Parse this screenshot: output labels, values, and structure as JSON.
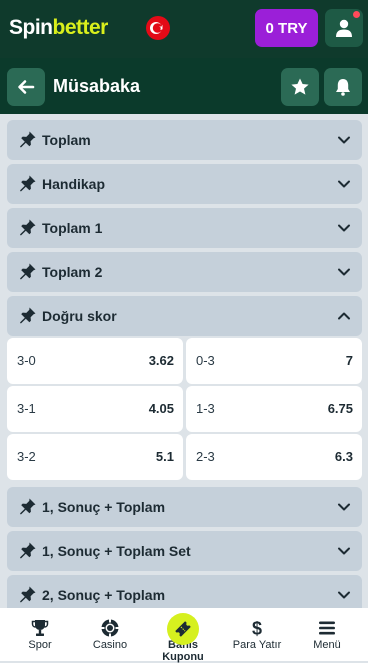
{
  "header": {
    "logo_part1": "Spin",
    "logo_part2": "better",
    "flag_icon": "turkey-flag-icon",
    "balance": "0 TRY",
    "colors": {
      "header_bg": "#0f3a2c",
      "balance_bg": "#9b1fd8",
      "accent_lime": "#d9ef1c"
    }
  },
  "subheader": {
    "title": "Müsabaka"
  },
  "markets": [
    {
      "name": "Toplam",
      "expanded": false
    },
    {
      "name": "Handikap",
      "expanded": false
    },
    {
      "name": "Toplam 1",
      "expanded": false
    },
    {
      "name": "Toplam 2",
      "expanded": false
    },
    {
      "name": "Doğru skor",
      "expanded": true
    },
    {
      "name": "1, Sonuç + Toplam",
      "expanded": false
    },
    {
      "name": "1, Sonuç + Toplam Set",
      "expanded": false
    },
    {
      "name": "2, Sonuç + Toplam",
      "expanded": false
    }
  ],
  "correct_score": [
    {
      "left": {
        "label": "3-0",
        "odd": "3.62"
      },
      "right": {
        "label": "0-3",
        "odd": "7"
      }
    },
    {
      "left": {
        "label": "3-1",
        "odd": "4.05"
      },
      "right": {
        "label": "1-3",
        "odd": "6.75"
      }
    },
    {
      "left": {
        "label": "3-2",
        "odd": "5.1"
      },
      "right": {
        "label": "2-3",
        "odd": "6.3"
      }
    }
  ],
  "bottom_nav": [
    {
      "label": "Spor",
      "icon": "trophy-icon"
    },
    {
      "label": "Casino",
      "icon": "poker-chip-icon"
    },
    {
      "label": "Bahis Kuponu",
      "icon": "ticket-icon",
      "active": true
    },
    {
      "label": "Para Yatır",
      "icon": "dollar-icon"
    },
    {
      "label": "Menü",
      "icon": "menu-icon"
    }
  ]
}
